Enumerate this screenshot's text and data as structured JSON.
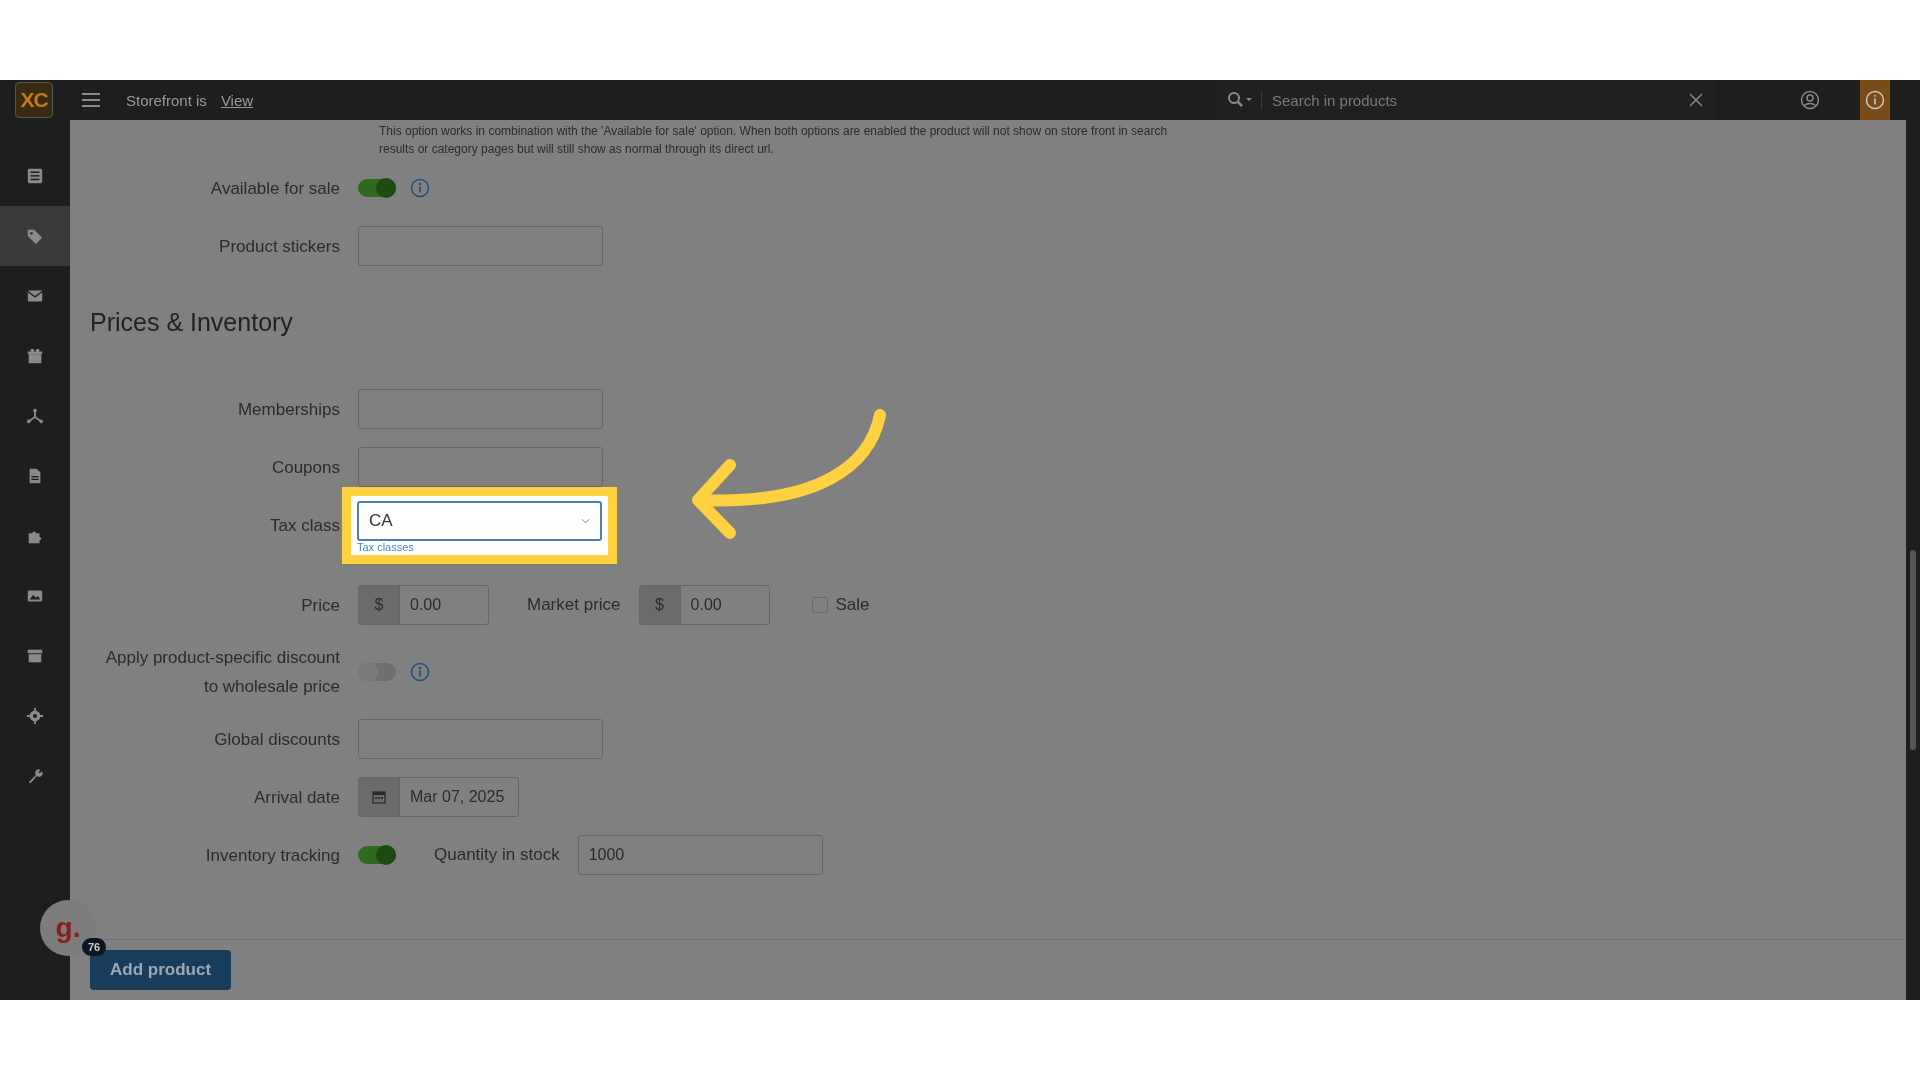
{
  "header": {
    "logo": "XC",
    "storefront_label": "Storefront is",
    "view_link": "View",
    "search": {
      "placeholder": "Search in products"
    }
  },
  "sidebar": {
    "items": [
      {
        "selected": false
      },
      {
        "selected": true
      },
      {
        "selected": false
      },
      {
        "selected": false
      },
      {
        "selected": false
      },
      {
        "selected": false
      },
      {
        "selected": false
      },
      {
        "selected": false
      },
      {
        "selected": false
      },
      {
        "selected": false
      },
      {
        "selected": false
      }
    ]
  },
  "help_text": "This option works in combination with the 'Available for sale' option. When both options are enabled the product will not show on store front in search results or category pages but will still show as normal through its direct url.",
  "top_rows": [
    {
      "kind": "toggle",
      "label": "Available for sale",
      "on": true
    },
    {
      "kind": "input",
      "label": "Product stickers"
    }
  ],
  "section_title": "Prices & Inventory",
  "rows": [
    {
      "kind": "input",
      "label": "Memberships"
    },
    {
      "kind": "input",
      "label": "Coupons"
    },
    {
      "kind": "select",
      "label": "Tax class",
      "value": "CA",
      "link": "Tax classes"
    },
    {
      "kind": "price",
      "label": "Price",
      "currency": "$",
      "value": "0.00",
      "market_label": "Market price",
      "market_currency": "$",
      "market_value": "0.00",
      "sale_label": "Sale",
      "sale_checked": false
    },
    {
      "kind": "toggle",
      "label": "Apply product-specific discount to wholesale price",
      "on": false
    },
    {
      "kind": "input",
      "label": "Global discounts"
    },
    {
      "kind": "date",
      "label": "Arrival date",
      "value": "Mar 07, 2025"
    },
    {
      "kind": "inventory",
      "label": "Inventory tracking",
      "on": true,
      "qty_label": "Quantity in stock",
      "qty_value": "1000"
    }
  ],
  "footer": {
    "button": "Add product",
    "avatar_letter": "g.",
    "badge": "76"
  }
}
